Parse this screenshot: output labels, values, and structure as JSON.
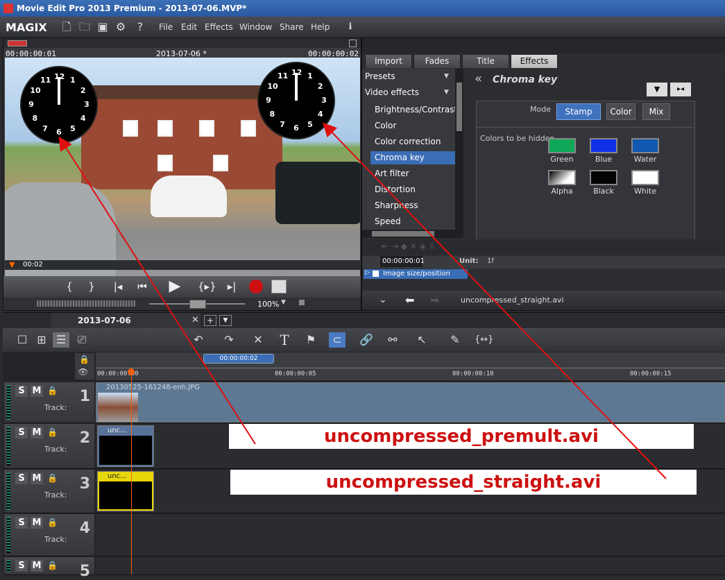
{
  "window": {
    "title": "Movie Edit Pro 2013 Premium - 2013-07-06.MVP*"
  },
  "menubar": {
    "brand": "MAGIX",
    "items": [
      "File",
      "Edit",
      "Effects",
      "Window",
      "Share",
      "Help"
    ]
  },
  "preview": {
    "time_left": "00:00:00:01",
    "title": "2013-07-06 *",
    "time_right": "00:00:00:02",
    "scrub_time": "00:02",
    "zoom": "100%",
    "clock_numbers": [
      "12",
      "1",
      "2",
      "3",
      "4",
      "5",
      "6",
      "7",
      "8",
      "9",
      "10",
      "11"
    ]
  },
  "effects": {
    "tabs": [
      "Import",
      "Fades",
      "Title",
      "Effects"
    ],
    "active_tab": "Effects",
    "presets_label": "Presets",
    "video_effects_label": "Video effects",
    "list": [
      "Brightness/Contrast",
      "Color",
      "Color correction",
      "Chroma key",
      "Art filter",
      "Distortion",
      "Sharpness",
      "Speed"
    ],
    "selected": "Chroma key",
    "panel_title": "Chroma key",
    "mode_label": "Mode",
    "modes": [
      "Stamp",
      "Color",
      "Mix"
    ],
    "active_mode": "Stamp",
    "hidden_label": "Colors to be hidden",
    "swatches": [
      {
        "name": "Green",
        "color": "#10a858"
      },
      {
        "name": "Blue",
        "color": "#1030e8"
      },
      {
        "name": "Water",
        "color": "#1058b0"
      },
      {
        "name": "Alpha",
        "color": "#ffffff"
      },
      {
        "name": "Black",
        "color": "#050505"
      },
      {
        "name": "White",
        "color": "#ffffff"
      }
    ],
    "kf_time": "00:00:00:01",
    "unit_label": "Unit:",
    "unit_value": "1f",
    "param_row": "Image size/position",
    "footer_file": "uncompressed_straight.avi"
  },
  "timeline": {
    "tab_name": "2013-07-06",
    "marker_time": "00:00:00:02",
    "ruler": [
      "00:00:00:00",
      "00:00:00:05",
      "00:00:00:10",
      "00:00:00:15"
    ],
    "track_label": "Track:",
    "tracks": [
      {
        "num": "1",
        "clip": "20130525-161248-enh.JPG"
      },
      {
        "num": "2",
        "clip": "unc..."
      },
      {
        "num": "3",
        "clip": "unc..."
      },
      {
        "num": "4"
      },
      {
        "num": "5"
      }
    ],
    "track_buttons": {
      "solo": "S",
      "mute": "M"
    }
  },
  "annotations": {
    "label_premult": "uncompressed_premult.avi",
    "label_straight": "uncompressed_straight.avi",
    "color": "#cc1111"
  }
}
